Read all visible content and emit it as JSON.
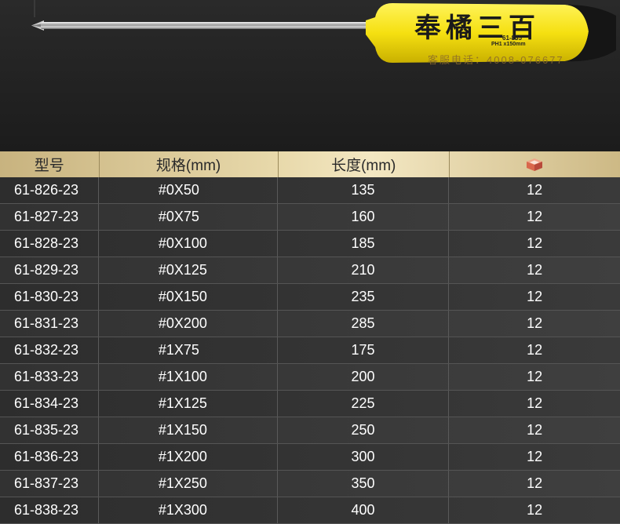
{
  "hero": {
    "brand": "奉橘三百",
    "model_tag": "61-835",
    "spec_tag": "PH1 x150mm",
    "service": "客服电话：4008-076677",
    "handle_color": "#f5e011"
  },
  "table": {
    "headers": {
      "model": "型号",
      "spec": "规格(mm)",
      "length": "长度(mm)",
      "qty_icon": "box-icon"
    },
    "rows": [
      {
        "model": "61-826-23",
        "spec": "#0X50",
        "length": "135",
        "qty": "12"
      },
      {
        "model": "61-827-23",
        "spec": "#0X75",
        "length": "160",
        "qty": "12"
      },
      {
        "model": "61-828-23",
        "spec": "#0X100",
        "length": "185",
        "qty": "12"
      },
      {
        "model": "61-829-23",
        "spec": "#0X125",
        "length": "210",
        "qty": "12"
      },
      {
        "model": "61-830-23",
        "spec": "#0X150",
        "length": "235",
        "qty": "12"
      },
      {
        "model": "61-831-23",
        "spec": "#0X200",
        "length": "285",
        "qty": "12"
      },
      {
        "model": "61-832-23",
        "spec": "#1X75",
        "length": "175",
        "qty": "12"
      },
      {
        "model": "61-833-23",
        "spec": "#1X100",
        "length": "200",
        "qty": "12"
      },
      {
        "model": "61-834-23",
        "spec": "#1X125",
        "length": "225",
        "qty": "12"
      },
      {
        "model": "61-835-23",
        "spec": "#1X150",
        "length": "250",
        "qty": "12"
      },
      {
        "model": "61-836-23",
        "spec": "#1X200",
        "length": "300",
        "qty": "12"
      },
      {
        "model": "61-837-23",
        "spec": "#1X250",
        "length": "350",
        "qty": "12"
      },
      {
        "model": "61-838-23",
        "spec": "#1X300",
        "length": "400",
        "qty": "12"
      }
    ]
  }
}
